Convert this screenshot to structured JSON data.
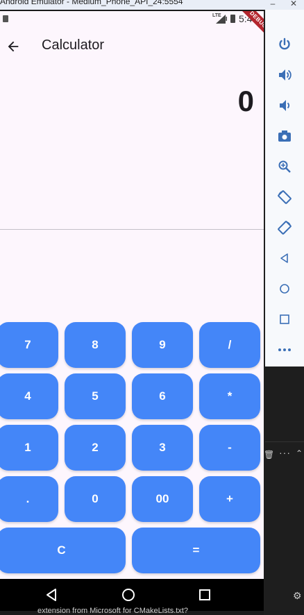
{
  "window": {
    "title": "Android Emulator - Medium_Phone_API_24:5554",
    "minimize": "–",
    "close": "✕"
  },
  "status_bar": {
    "network": "LTE",
    "time": "5:40"
  },
  "debug_banner": "DEBUG",
  "app_bar": {
    "title": "Calculator"
  },
  "display": {
    "value": "0"
  },
  "keypad": {
    "rows": [
      [
        "7",
        "8",
        "9",
        "/"
      ],
      [
        "4",
        "5",
        "6",
        "*"
      ],
      [
        "1",
        "2",
        "3",
        "-"
      ],
      [
        ".",
        "0",
        "00",
        "+"
      ],
      [
        "C",
        "="
      ]
    ]
  },
  "side_panel": {
    "items": [
      "power-icon",
      "volume-up-icon",
      "volume-down-icon",
      "camera-icon",
      "zoom-in-icon",
      "rotate-left-icon",
      "rotate-right-icon",
      "back-icon",
      "home-icon",
      "overview-icon",
      "more-icon"
    ]
  },
  "ide": {
    "more": "···",
    "footer_text": "extension from Microsoft for CMakeLists.txt?"
  },
  "colors": {
    "key_background": "#4486f8",
    "screen_background": "#fdf6fd",
    "debug_banner": "#b3262e"
  }
}
